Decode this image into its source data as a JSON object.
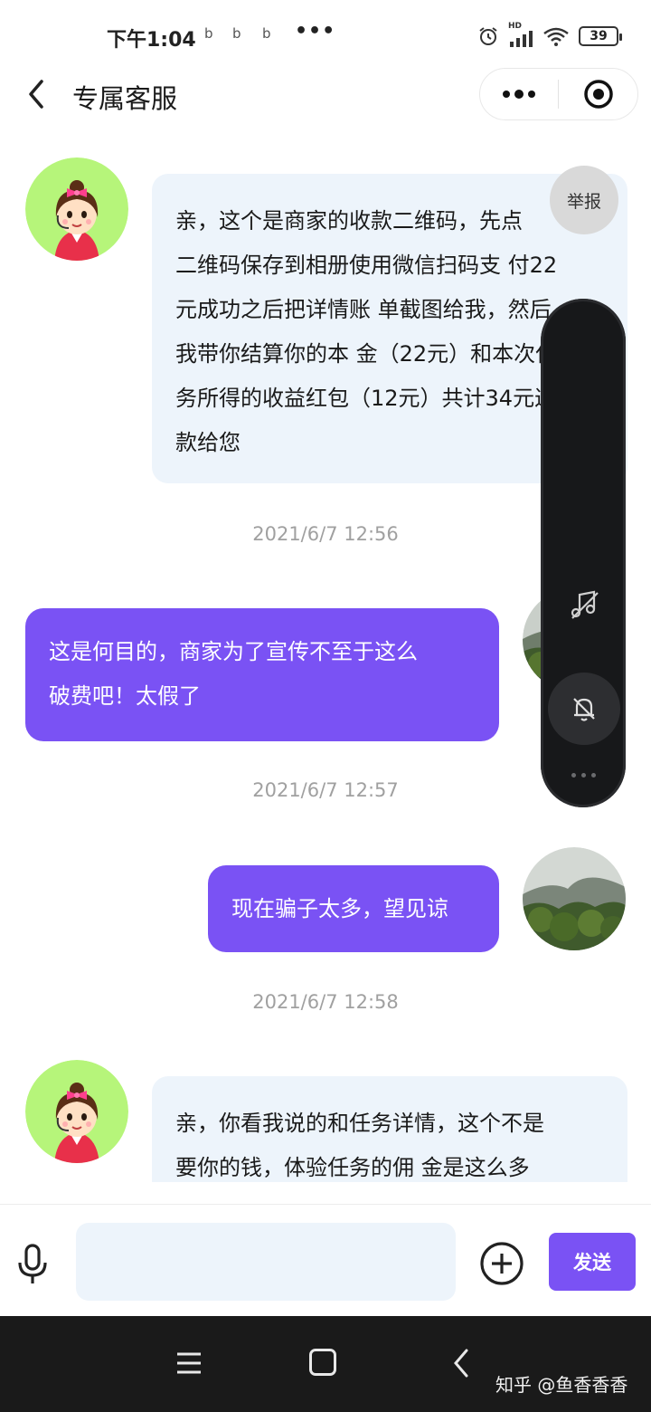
{
  "status_bar": {
    "time": "下午1:04",
    "notif_icons": [
      "b",
      "b",
      "b"
    ],
    "more": "•••",
    "network": "HD",
    "battery": "39"
  },
  "header": {
    "title": "专属客服",
    "back_icon": "chevron-left-icon",
    "more_icon": "more-dots-icon",
    "close_icon": "target-icon"
  },
  "colors": {
    "accent": "#7a52f4",
    "incoming_bubble": "#edf4fb",
    "timestamp": "#a0a0a0",
    "float_panel": "#17181a"
  },
  "messages": [
    {
      "direction": "incoming",
      "lines": [
        "亲，这个是商家的收款二维码，先点",
        "二维码保存到相册使用微信扫码支 付22",
        "元成功之后把详情账 单截图给我，然后",
        "我带你结算你的本 金（22元）和本次任",
        "务所得的收益红包（12元）共计34元返",
        "款给您"
      ]
    },
    {
      "timestamp": "2021/6/7 12:56"
    },
    {
      "direction": "outgoing",
      "lines": [
        "这是何目的，商家为了宣传不至于这么",
        "破费吧！太假了"
      ]
    },
    {
      "timestamp": "2021/6/7 12:57"
    },
    {
      "direction": "outgoing",
      "lines": [
        "现在骗子太多，望见谅"
      ]
    },
    {
      "timestamp": "2021/6/7 12:58"
    },
    {
      "direction": "incoming",
      "lines": [
        "亲，你看我说的和任务详情，这个不是",
        "要你的钱，体验任务的佣 金是这么多"
      ]
    }
  ],
  "overlay": {
    "report_label": "举报",
    "music_icon": "music-off-icon",
    "bell_icon": "bell-off-icon",
    "more_icon": "more-dots-icon"
  },
  "input_bar": {
    "mic_icon": "microphone-icon",
    "input_value": "",
    "plus_icon": "plus-circle-icon",
    "send_label": "发送"
  },
  "nav_bar": {
    "menu_icon": "menu-icon",
    "home_icon": "home-square-icon",
    "back_icon": "back-chevron-icon",
    "watermark": "知乎 @鱼香香香"
  }
}
